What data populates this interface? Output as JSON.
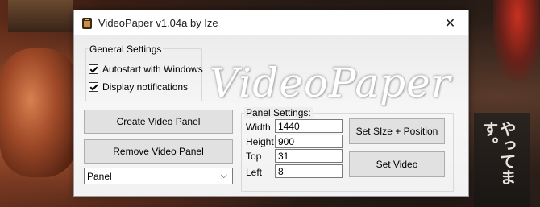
{
  "window": {
    "title": "VideoPaper v1.04a by Ize",
    "close_glyph": "✕",
    "icon": "app-icon"
  },
  "logo_text": "VideoPaper",
  "general_settings": {
    "title": "General Settings",
    "options": [
      {
        "label": "Autostart with Windows",
        "checked": true
      },
      {
        "label": "Display notifications",
        "checked": true
      }
    ]
  },
  "actions": {
    "create_label": "Create Video Panel",
    "remove_label": "Remove Video Panel",
    "panel_select_value": "Panel"
  },
  "panel_settings": {
    "title": "Panel Settings:",
    "width_label": "Width",
    "width_value": "1440",
    "height_label": "Height",
    "height_value": "900",
    "top_label": "Top",
    "top_value": "31",
    "left_label": "Left",
    "left_value": "8",
    "set_size_label": "Set SIze + Position",
    "set_video_label": "Set Video"
  },
  "background_sign_text": "やってます。"
}
